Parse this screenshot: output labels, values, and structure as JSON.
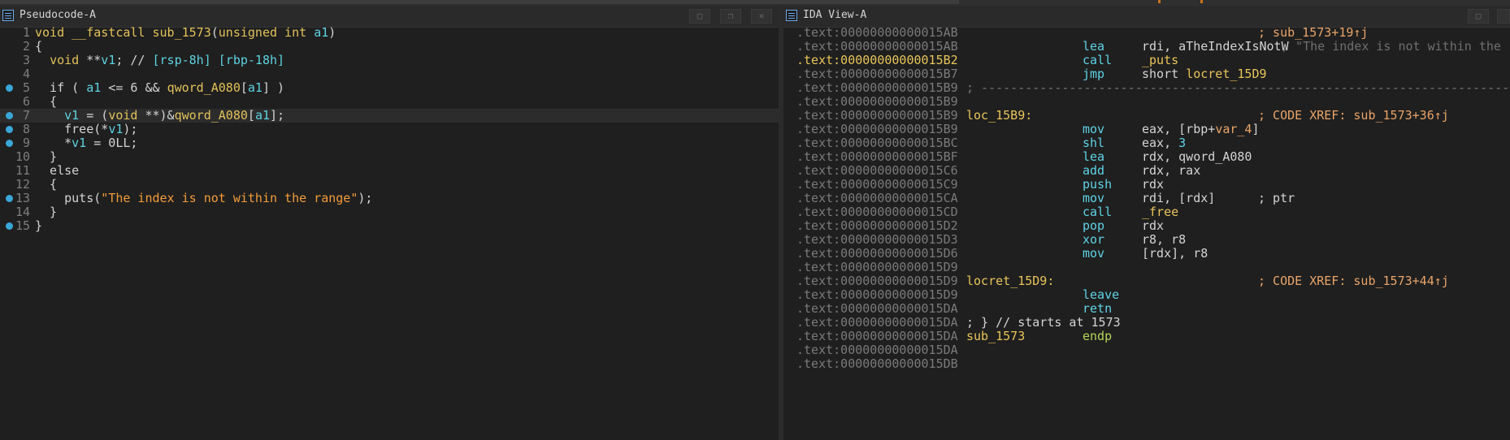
{
  "colors": {
    "background": "#1f1f1f",
    "keyword": "#e2c25a",
    "variable": "#5ed2e0",
    "string": "#f39c3b",
    "breakpoint": "#39a7d8",
    "comment": "#e9a46a"
  },
  "left_pane": {
    "title": "Pseudocode-A",
    "buttons": [
      "restore-icon",
      "float-icon",
      "close-icon"
    ],
    "lines": [
      {
        "n": "1",
        "bp": false,
        "cur": false,
        "parts": [
          [
            "kw",
            "void __fastcall sub_1573"
          ],
          [
            "op",
            "("
          ],
          [
            "kw",
            "unsigned int "
          ],
          [
            "var",
            "a1"
          ],
          [
            "op",
            ")"
          ]
        ]
      },
      {
        "n": "2",
        "bp": false,
        "cur": false,
        "parts": [
          [
            "op",
            "{"
          ]
        ]
      },
      {
        "n": "3",
        "bp": false,
        "cur": false,
        "parts": [
          [
            "op",
            "  "
          ],
          [
            "kw",
            "void"
          ],
          [
            "op",
            " **"
          ],
          [
            "var",
            "v1"
          ],
          [
            "op",
            "; // "
          ],
          [
            "var",
            "[rsp-8h] [rbp-18h]"
          ]
        ]
      },
      {
        "n": "4",
        "bp": false,
        "cur": false,
        "parts": []
      },
      {
        "n": "5",
        "bp": true,
        "cur": false,
        "parts": [
          [
            "op",
            "  if ( "
          ],
          [
            "var",
            "a1"
          ],
          [
            "op",
            " <= 6 && "
          ],
          [
            "fn",
            "qword_A080"
          ],
          [
            "op",
            "["
          ],
          [
            "var",
            "a1"
          ],
          [
            "op",
            "] )"
          ]
        ]
      },
      {
        "n": "6",
        "bp": false,
        "cur": false,
        "parts": [
          [
            "op",
            "  {"
          ]
        ]
      },
      {
        "n": "7",
        "bp": true,
        "cur": true,
        "parts": [
          [
            "op",
            "    "
          ],
          [
            "var",
            "v1"
          ],
          [
            "op",
            " = ("
          ],
          [
            "kw",
            "void"
          ],
          [
            "op",
            " **)&"
          ],
          [
            "fn",
            "qword_A080"
          ],
          [
            "op",
            "["
          ],
          [
            "var",
            "a1"
          ],
          [
            "op",
            "];"
          ]
        ]
      },
      {
        "n": "8",
        "bp": true,
        "cur": false,
        "parts": [
          [
            "op",
            "    free(*"
          ],
          [
            "var",
            "v1"
          ],
          [
            "op",
            ");"
          ]
        ]
      },
      {
        "n": "9",
        "bp": true,
        "cur": false,
        "parts": [
          [
            "op",
            "    *"
          ],
          [
            "var",
            "v1"
          ],
          [
            "op",
            " = 0LL;"
          ]
        ]
      },
      {
        "n": "10",
        "bp": false,
        "cur": false,
        "parts": [
          [
            "op",
            "  }"
          ]
        ]
      },
      {
        "n": "11",
        "bp": false,
        "cur": false,
        "parts": [
          [
            "op",
            "  else"
          ]
        ]
      },
      {
        "n": "12",
        "bp": false,
        "cur": false,
        "parts": [
          [
            "op",
            "  {"
          ]
        ]
      },
      {
        "n": "13",
        "bp": true,
        "cur": false,
        "parts": [
          [
            "op",
            "    puts("
          ],
          [
            "str",
            "\"The index is not within the range\""
          ],
          [
            "op",
            ");"
          ]
        ]
      },
      {
        "n": "14",
        "bp": false,
        "cur": false,
        "parts": [
          [
            "op",
            "  }"
          ]
        ]
      },
      {
        "n": "15",
        "bp": true,
        "cur": false,
        "parts": [
          [
            "op",
            "}"
          ]
        ]
      }
    ]
  },
  "right_pane": {
    "title": "IDA View-A",
    "buttons": [
      "restore-icon",
      "close-icon"
    ],
    "lines": [
      {
        "addr": ".text:00000000000015AB",
        "hl": false,
        "label": "",
        "mnem": "",
        "ops": "",
        "cmt": "; sub_1573+19↑j",
        "kind": "code"
      },
      {
        "addr": ".text:00000000000015AB",
        "hl": false,
        "label": "",
        "mnem": "lea",
        "ops": "rdi, aTheIndexIsNotW",
        "cmt": "; \"The index is not within the",
        "cmtGrey": true,
        "kind": "code"
      },
      {
        "addr": ".text:00000000000015B2",
        "hl": true,
        "label": "",
        "mnem": "call",
        "ops": "_puts",
        "opsYel": true,
        "cmt": "",
        "kind": "code"
      },
      {
        "addr": ".text:00000000000015B7",
        "hl": false,
        "label": "",
        "mnem": "jmp",
        "ops": "short locret_15D9",
        "cmt": "",
        "kind": "jmp"
      },
      {
        "addr": ".text:00000000000015B9",
        "hl": false,
        "kind": "sep",
        "text": "; ---------------------------------------------------------------------------"
      },
      {
        "addr": ".text:00000000000015B9",
        "hl": false,
        "kind": "blank"
      },
      {
        "addr": ".text:00000000000015B9",
        "hl": false,
        "label": "loc_15B9:",
        "mnem": "",
        "ops": "",
        "cmt": "; CODE XREF: sub_1573+36↑j",
        "kind": "code"
      },
      {
        "addr": ".text:00000000000015B9",
        "hl": false,
        "label": "",
        "mnem": "mov",
        "ops": "eax, [rbp+var_4]",
        "cmt": "",
        "kind": "var4"
      },
      {
        "addr": ".text:00000000000015BC",
        "hl": false,
        "label": "",
        "mnem": "shl",
        "ops": "eax, 3",
        "cmt": "",
        "kind": "shl"
      },
      {
        "addr": ".text:00000000000015BF",
        "hl": false,
        "label": "",
        "mnem": "lea",
        "ops": "rdx, qword_A080",
        "cmt": "",
        "kind": "code"
      },
      {
        "addr": ".text:00000000000015C6",
        "hl": false,
        "label": "",
        "mnem": "add",
        "ops": "rdx, rax",
        "cmt": "",
        "kind": "code"
      },
      {
        "addr": ".text:00000000000015C9",
        "hl": false,
        "label": "",
        "mnem": "push",
        "ops": "rdx",
        "cmt": "",
        "kind": "code"
      },
      {
        "addr": ".text:00000000000015CA",
        "hl": false,
        "label": "",
        "mnem": "mov",
        "ops": "rdi, [rdx]",
        "cmt": "; ptr",
        "cmtWhite": true,
        "kind": "code"
      },
      {
        "addr": ".text:00000000000015CD",
        "hl": false,
        "label": "",
        "mnem": "call",
        "ops": "_free",
        "opsYel": true,
        "cmt": "",
        "kind": "code"
      },
      {
        "addr": ".text:00000000000015D2",
        "hl": false,
        "label": "",
        "mnem": "pop",
        "ops": "rdx",
        "cmt": "",
        "kind": "code"
      },
      {
        "addr": ".text:00000000000015D3",
        "hl": false,
        "label": "",
        "mnem": "xor",
        "ops": "r8, r8",
        "cmt": "",
        "kind": "code"
      },
      {
        "addr": ".text:00000000000015D6",
        "hl": false,
        "label": "",
        "mnem": "mov",
        "ops": "[rdx], r8",
        "cmt": "",
        "kind": "code"
      },
      {
        "addr": ".text:00000000000015D9",
        "hl": false,
        "kind": "blank"
      },
      {
        "addr": ".text:00000000000015D9",
        "hl": false,
        "label": "locret_15D9:",
        "mnem": "",
        "ops": "",
        "cmt": "; CODE XREF: sub_1573+44↑j",
        "kind": "code"
      },
      {
        "addr": ".text:00000000000015D9",
        "hl": false,
        "label": "",
        "mnem": "leave",
        "ops": "",
        "cmt": "",
        "kind": "code"
      },
      {
        "addr": ".text:00000000000015DA",
        "hl": false,
        "label": "",
        "mnem": "retn",
        "ops": "",
        "cmt": "",
        "kind": "code"
      },
      {
        "addr": ".text:00000000000015DA",
        "hl": false,
        "kind": "end",
        "text": "; } // starts at 1573"
      },
      {
        "addr": ".text:00000000000015DA",
        "hl": false,
        "label": "sub_1573",
        "mnem": "endp",
        "mnemGreen": true,
        "ops": "",
        "cmt": "",
        "kind": "code"
      },
      {
        "addr": ".text:00000000000015DA",
        "hl": false,
        "kind": "blank"
      },
      {
        "addr": ".text:00000000000015DB",
        "hl": false,
        "kind": "blank"
      }
    ]
  }
}
